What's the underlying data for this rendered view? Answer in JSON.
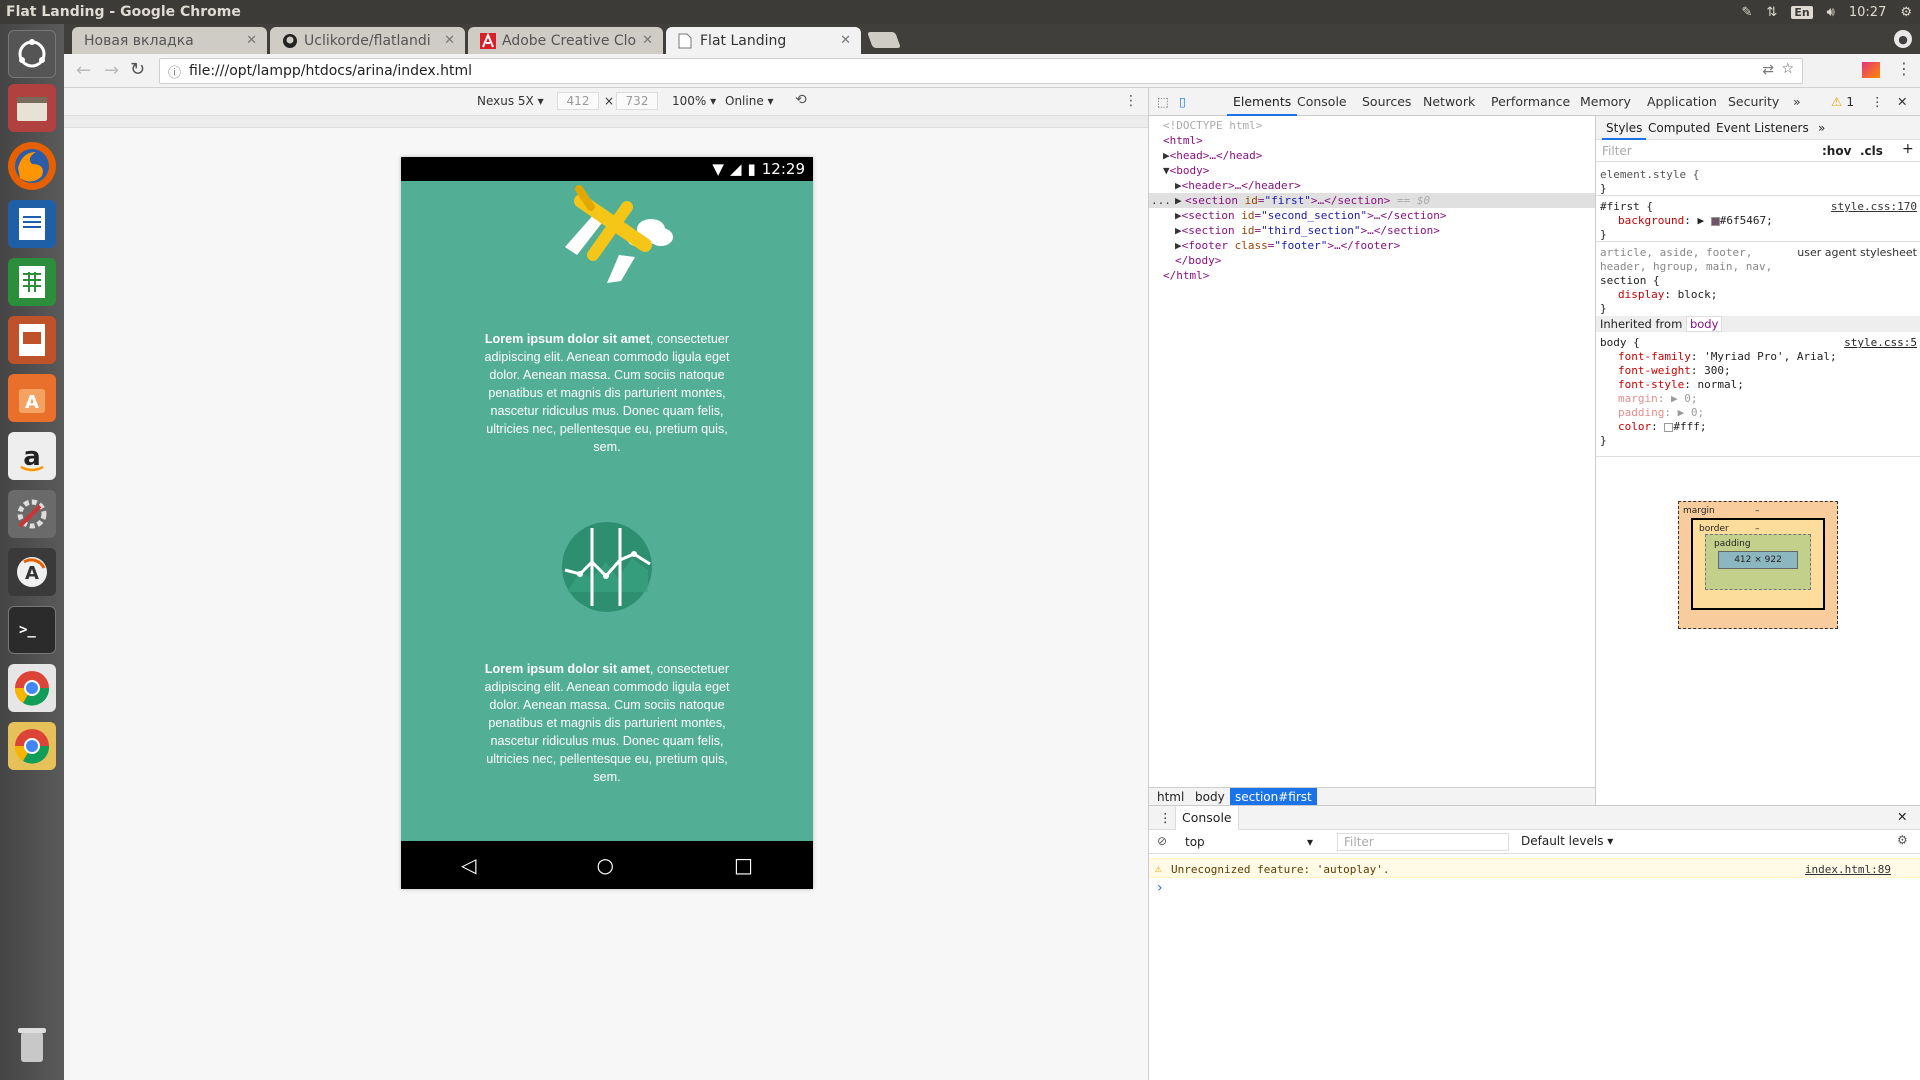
{
  "window_title": "Flat Landing - Google Chrome",
  "system": {
    "time": "10:27",
    "keyboard": "En"
  },
  "tabs": [
    {
      "label": "Новая вкладка"
    },
    {
      "label": "Uclikorde/flatlandi"
    },
    {
      "label": "Adobe Creative Clo"
    },
    {
      "label": "Flat Landing"
    }
  ],
  "url": "file:///opt/lampp/htdocs/arina/index.html",
  "device_toolbar": {
    "device": "Nexus 5X",
    "width": "412",
    "height": "732",
    "times": "×",
    "zoom": "100%",
    "network": "Online"
  },
  "phone": {
    "time": "12:29",
    "paragraph1_bold": "Lorem ipsum dolor sit amet",
    "paragraph1_rest": ", consectetuer adipiscing elit. Aenean commodo ligula eget dolor. Aenean massa. Cum sociis natoque penatibus et magnis dis parturient montes, nascetur ridiculus mus. Donec quam felis, ultricies nec, pellentesque eu, pretium quis, sem.",
    "paragraph2_bold": "Lorem ipsum dolor sit amet",
    "paragraph2_rest": ", consectetuer adipiscing elit. Aenean commodo ligula eget dolor. Aenean massa. Cum sociis natoque penatibus et magnis dis parturient montes, nascetur ridiculus mus. Donec quam felis, ultricies nec, pellentesque eu, pretium quis, sem."
  },
  "devtools": {
    "tabs": [
      "Elements",
      "Console",
      "Sources",
      "Network",
      "Performance",
      "Memory",
      "Application",
      "Security"
    ],
    "more": "»",
    "warning_count": "1",
    "dom": {
      "doctype": "<!DOCTYPE html>",
      "html_open": "<html>",
      "head": "<head>…</head>",
      "body_open": "<body>",
      "header": "<header>…</header>",
      "section_first_tag": "<section",
      "section_first_attr": "id",
      "section_first_val": "\"first\"",
      "section_first_end": ">…</section>",
      "selected_marker": "== $0",
      "section_second_val": "\"second_section\"",
      "section_third_val": "\"third_section\"",
      "footer_tag": "<footer",
      "footer_attr": "class",
      "footer_val": "\"footer\"",
      "footer_end": ">…</footer>",
      "body_close": "</body>",
      "html_close": "</html>",
      "ellipsis": "..."
    },
    "breadcrumbs": [
      "html",
      "body",
      "section#first"
    ],
    "styles_tabs": [
      "Styles",
      "Computed",
      "Event Listeners"
    ],
    "styles_more": "»",
    "filter_placeholder": "Filter",
    "hov": ":hov",
    "cls": ".cls",
    "plus": "+",
    "styles": {
      "element_style": "element.style {",
      "close": "}",
      "first_selector": "#first {",
      "first_source": "style.css:170",
      "first_prop": "background",
      "first_value": "#6f5467;",
      "ua_selector_line1": "article, aside, footer,",
      "ua_source": "user agent stylesheet",
      "ua_selector_line2": "header, hgroup, main, nav,",
      "ua_selector_line3": "section {",
      "ua_prop": "display",
      "ua_value": "block;",
      "inherited_label": "Inherited from",
      "inherited_tag": "body",
      "body_selector": "body {",
      "body_source": "style.css:5",
      "props": [
        {
          "name": "font-family",
          "value": "'Myriad Pro', Arial;"
        },
        {
          "name": "font-weight",
          "value": "300;"
        },
        {
          "name": "font-style",
          "value": "normal;"
        },
        {
          "name": "margin",
          "value": "▶ 0;"
        },
        {
          "name": "padding",
          "value": "▶ 0;"
        },
        {
          "name": "color",
          "value": "#fff;"
        }
      ]
    },
    "box_model": {
      "margin": "margin",
      "border": "border",
      "padding": "padding",
      "dash": "–",
      "content": "412 × 922"
    },
    "console": {
      "title": "Console",
      "context": "top",
      "filter_placeholder": "Filter",
      "levels": "Default levels",
      "warning": "Unrecognized feature: 'autoplay'.",
      "warning_source": "index.html:89",
      "prompt": "›"
    }
  },
  "colors": {
    "phone_bg": "#52ae95",
    "first_bg": "#6f5467",
    "accent": "#1a73e8"
  }
}
